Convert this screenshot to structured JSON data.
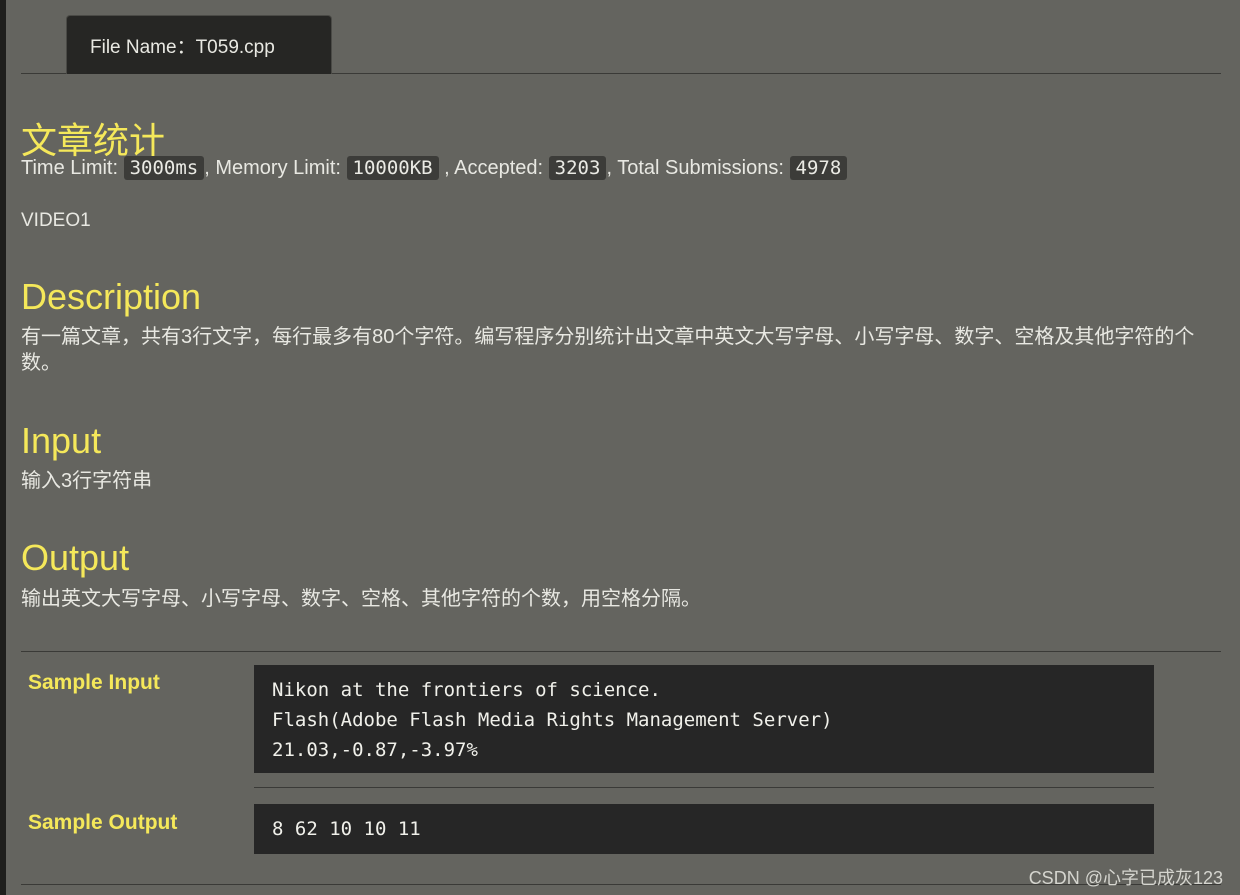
{
  "tab": {
    "label": "File Name：T059.cpp"
  },
  "problem": {
    "title": "文章统计",
    "stats": {
      "time_label": "Time Limit:",
      "time_value": "3000ms",
      "memory_label": ", Memory Limit:",
      "memory_value": "10000KB",
      "accepted_label": ", Accepted:",
      "accepted_value": "3203",
      "total_label": ", Total Submissions:",
      "total_value": "4978"
    },
    "source": "VIDEO1"
  },
  "sections": {
    "description": {
      "heading": "Description",
      "text": "有一篇文章，共有3行文字，每行最多有80个字符。编写程序分别统计出文章中英文大写字母、小写字母、数字、空格及其他字符的个数。"
    },
    "input": {
      "heading": "Input",
      "text": "输入3行字符串"
    },
    "output": {
      "heading": "Output",
      "text": "输出英文大写字母、小写字母、数字、空格、其他字符的个数，用空格分隔。"
    }
  },
  "samples": {
    "input_label": "Sample Input",
    "input_lines": [
      "Nikon at the frontiers of science.",
      "Flash(Adobe Flash Media Rights Management Server)",
      "21.03,-0.87,-3.97%"
    ],
    "output_label": "Sample Output",
    "output_lines": [
      "8 62 10 10 11"
    ]
  },
  "watermark": "CSDN @心字已成灰123"
}
